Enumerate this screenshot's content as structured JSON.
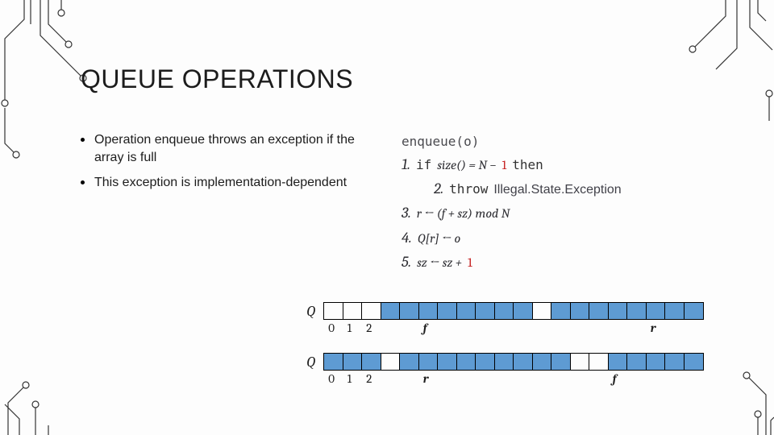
{
  "title": "QUEUE OPERATIONS",
  "bullets": [
    "Operation enqueue throws an exception if the array is full",
    "This exception is implementation-dependent"
  ],
  "algo": {
    "fn": "enqueue(o)",
    "l1_kw": "if",
    "l1_cond": "size() = N − ",
    "l1_one": "1",
    "l1_then": "then",
    "l2_kw": "throw",
    "l2_ex": "Illegal.State.Exception",
    "l3": "r ← (f + sz) mod N",
    "l4": "Q[r] ← o",
    "l5": "sz ← sz + ",
    "l5_one": "1"
  },
  "chart_data": [
    {
      "type": "table",
      "label": "Q",
      "cells": 20,
      "filled_ranges": [
        [
          3,
          11
        ],
        [
          12,
          20
        ]
      ],
      "index_labels": {
        "0": "0",
        "1": "1",
        "2": "2"
      },
      "pointers": {
        "f": 5,
        "r": 17
      }
    },
    {
      "type": "table",
      "label": "Q",
      "cells": 20,
      "filled_ranges": [
        [
          0,
          3
        ],
        [
          4,
          13
        ],
        [
          15,
          20
        ]
      ],
      "index_labels": {
        "0": "0",
        "1": "1",
        "2": "2"
      },
      "pointers": {
        "r": 5,
        "f": 15
      }
    }
  ]
}
